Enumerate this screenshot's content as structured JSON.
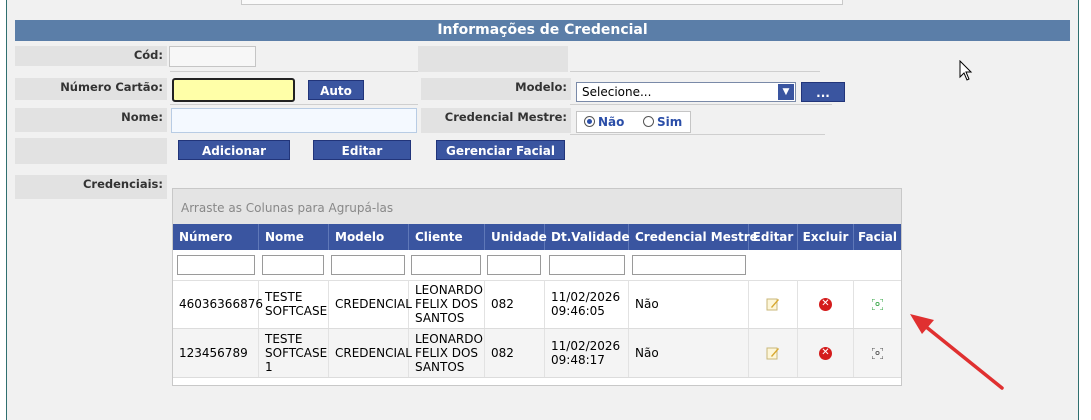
{
  "section_title": "Informações de Credencial",
  "form": {
    "cod_label": "Cód:",
    "numero_cartao_label": "Número Cartão:",
    "auto_button": "Auto",
    "nome_label": "Nome:",
    "modelo_label": "Modelo:",
    "modelo_selected": "Selecione...",
    "more_button": "...",
    "credencial_mestre_label": "Credencial Mestre:",
    "radio_nao": "Não",
    "radio_sim": "Sim",
    "radio_selected": "Não",
    "adicionar_button": "Adicionar",
    "editar_button": "Editar",
    "gerenciar_facial_button": "Gerenciar Facial",
    "credenciais_label": "Credenciais:"
  },
  "grid": {
    "group_hint": "Arraste as Colunas para Agrupá-las",
    "columns": [
      "Número",
      "Nome",
      "Modelo",
      "Cliente",
      "Unidade",
      "Dt.Validade",
      "Credencial Mestre",
      "Editar",
      "Excluir",
      "Facial"
    ],
    "rows": [
      {
        "numero": "46036366876",
        "nome": "TESTE SOFTCASE",
        "modelo": "CREDENCIAL",
        "cliente": "LEONARDO FELIX DOS SANTOS",
        "unidade": "082",
        "validade": "11/02/2026 09:46:05",
        "mestre": "Não"
      },
      {
        "numero": "123456789",
        "nome": "TESTE SOFTCASE 1",
        "modelo": "CREDENCIAL",
        "cliente": "LEONARDO FELIX DOS SANTOS",
        "unidade": "082",
        "validade": "11/02/2026 09:48:17",
        "mestre": "Não"
      }
    ]
  },
  "colors": {
    "header_blue": "#5b7ea8",
    "grid_header": "#3a55a0",
    "arrow_red": "#e03030"
  }
}
